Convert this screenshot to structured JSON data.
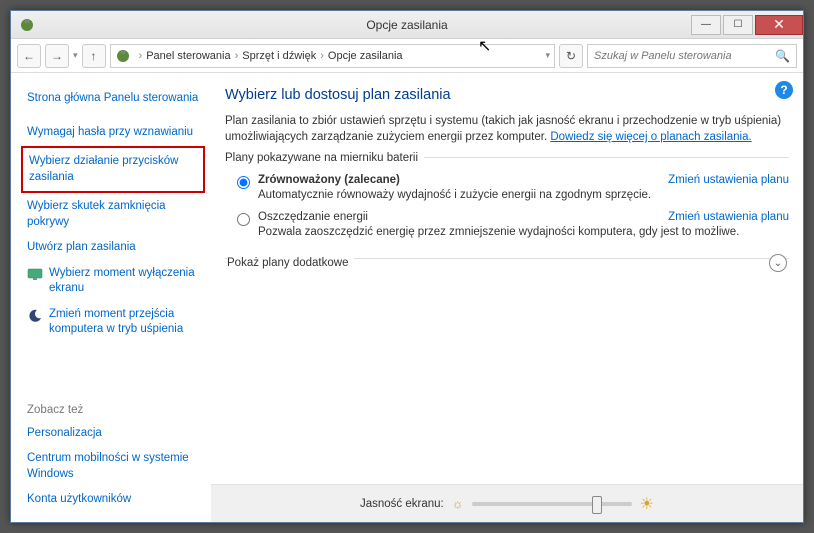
{
  "titlebar": {
    "title": "Opcje zasilania"
  },
  "breadcrumb": {
    "items": [
      "Panel sterowania",
      "Sprzęt i dźwięk",
      "Opcje zasilania"
    ]
  },
  "search": {
    "placeholder": "Szukaj w Panelu sterowania"
  },
  "sidebar": {
    "home": "Strona główna Panelu sterowania",
    "links": [
      "Wymagaj hasła przy wznawianiu",
      "Wybierz działanie przycisków zasilania",
      "Wybierz skutek zamknięcia pokrywy",
      "Utwórz plan zasilania",
      "Wybierz moment wyłączenia ekranu",
      "Zmień moment przejścia komputera w tryb uśpienia"
    ],
    "seealso_header": "Zobacz też",
    "seealso": [
      "Personalizacja",
      "Centrum mobilności w systemie Windows",
      "Konta użytkowników"
    ]
  },
  "main": {
    "title": "Wybierz lub dostosuj plan zasilania",
    "desc_pre": "Plan zasilania to zbiór ustawień sprzętu i systemu (takich jak jasność ekranu i przechodzenie w tryb uśpienia) umożliwiających zarządzanie zużyciem energii przez komputer. ",
    "desc_link": "Dowiedz się więcej o planach zasilania.",
    "group_label": "Plany pokazywane na mierniku baterii",
    "plans": [
      {
        "name": "Zrównoważony (zalecane)",
        "desc": "Automatycznie równoważy wydajność i zużycie energii na zgodnym sprzęcie.",
        "link": "Zmień ustawienia planu",
        "checked": true
      },
      {
        "name": "Oszczędzanie energii",
        "desc": "Pozwala zaoszczędzić energię przez zmniejszenie wydajności komputera, gdy jest to możliwe.",
        "link": "Zmień ustawienia planu",
        "checked": false
      }
    ],
    "expand_label": "Pokaż plany dodatkowe",
    "brightness_label": "Jasność ekranu:"
  }
}
